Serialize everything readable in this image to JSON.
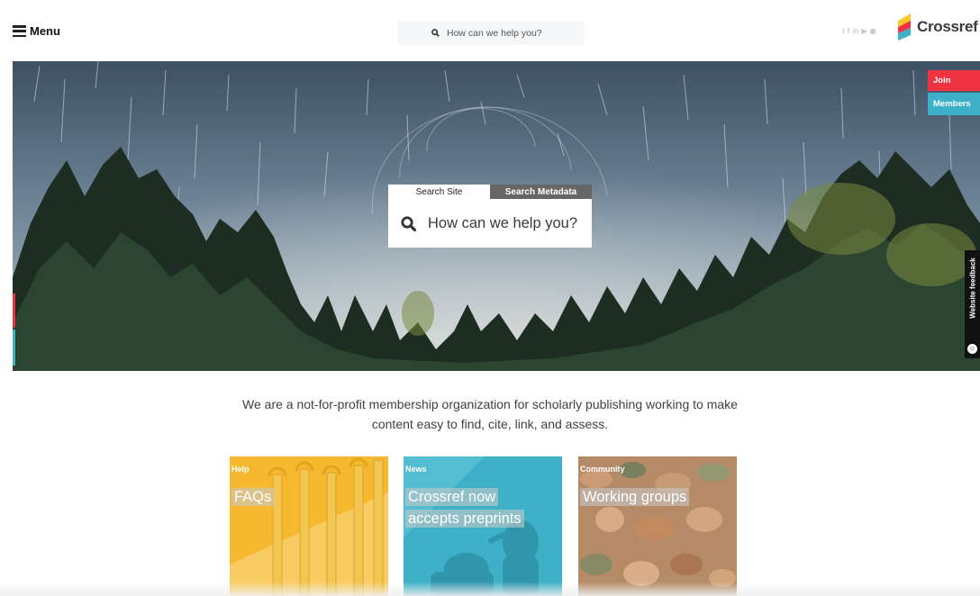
{
  "header": {
    "menu_label": "Menu",
    "search_placeholder": "How can we help you?",
    "social_icons": [
      "twitter-icon",
      "facebook-icon",
      "linkedin-icon",
      "youtube-icon",
      "rss-icon"
    ],
    "logo_text": "Crossref"
  },
  "hero": {
    "join_label": "Join",
    "members_label": "Members",
    "feedback_label": "Website feedback",
    "search": {
      "tabs": [
        {
          "label": "Search Site",
          "active": true
        },
        {
          "label": "Search Metadata",
          "active": false
        }
      ],
      "placeholder": "How can we help you?"
    }
  },
  "mission": "We are a not-for-profit membership organization for scholarly publishing working to make content easy to find, cite, link, and assess.",
  "cards": [
    {
      "category": "Help",
      "title": "FAQs",
      "color": "#f5b82e"
    },
    {
      "category": "News",
      "title_lines": [
        "Crossref now",
        "accepts preprints"
      ],
      "color": "#3eb1c8"
    },
    {
      "category": "Community",
      "title": "Working groups",
      "color": "#b48b66"
    }
  ],
  "colors": {
    "join": "#ef3340",
    "members": "#3eb1c8",
    "logo_yellow": "#ffc72c",
    "logo_red": "#ef3340",
    "logo_blue": "#3eb1c8"
  }
}
